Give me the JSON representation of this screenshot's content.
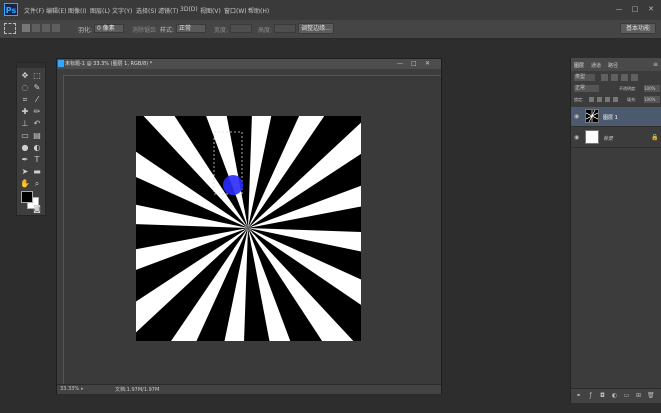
{
  "app": {
    "logo_text": "Ps"
  },
  "menu": {
    "items": [
      {
        "label": "文件(F)"
      },
      {
        "label": "编辑(E)"
      },
      {
        "label": "图像(I)"
      },
      {
        "label": "图层(L)"
      },
      {
        "label": "文字(Y)"
      },
      {
        "label": "选择(S)"
      },
      {
        "label": "滤镜(T)"
      },
      {
        "label": "3D(D)"
      },
      {
        "label": "视图(V)"
      },
      {
        "label": "窗口(W)"
      },
      {
        "label": "帮助(H)"
      }
    ],
    "window_controls": {
      "minimize": "—",
      "maximize": "□",
      "close": "✕"
    }
  },
  "options_bar": {
    "feather_label": "羽化:",
    "feather_value": "0 像素",
    "antialias_label": "消除锯齿",
    "style_label": "样式:",
    "style_value": "正常",
    "width_label": "宽度:",
    "height_label": "高度:",
    "refine_edge_label": "调整边缘...",
    "workspace_label": "基本功能"
  },
  "document": {
    "title": "未标题-1 @ 33.3% (图层 1, RGB/8) *",
    "zoom": "33.33%",
    "status_info": "文档:1.97M/1.97M",
    "controls": {
      "minimize": "—",
      "maximize": "□",
      "close": "✕"
    }
  },
  "layers_panel": {
    "tabs": [
      "图层",
      "通道",
      "路径"
    ],
    "kind_filter": "类型",
    "blend_mode": "正常",
    "opacity_label": "不透明度:",
    "opacity_value": "100%",
    "lock_label": "锁定:",
    "fill_label": "填充:",
    "fill_value": "100%",
    "layers": [
      {
        "name": "图层 1",
        "selected": true,
        "thumbnail": "starburst"
      },
      {
        "name": "背景",
        "selected": false,
        "thumbnail": "white"
      }
    ]
  },
  "colors": {
    "accent": "#31a8ff",
    "canvas_bg": "#000000",
    "ray": "#ffffff",
    "brush_cursor": "#2a2aff",
    "selected_layer": "#4b5a6e"
  },
  "canvas": {
    "ray_count": 16,
    "center": "center",
    "selection": "dashed rectangle"
  }
}
